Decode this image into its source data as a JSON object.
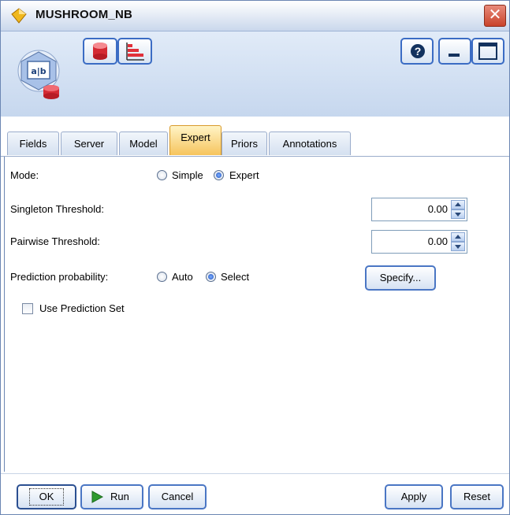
{
  "window": {
    "title": "MUSHROOM_NB",
    "close_glyph": "✕"
  },
  "toolbar": {
    "help_glyph": "?",
    "icons": [
      "node-naive-bayes-icon",
      "database-icon",
      "chart-icon",
      "help-icon",
      "minimize-icon",
      "maximize-icon"
    ]
  },
  "tabs": [
    {
      "label": "Fields"
    },
    {
      "label": "Server"
    },
    {
      "label": "Model"
    },
    {
      "label": "Expert"
    },
    {
      "label": "Priors"
    },
    {
      "label": "Annotations"
    }
  ],
  "active_tab": "Expert",
  "mode": {
    "label": "Mode:",
    "options": [
      "Simple",
      "Expert"
    ],
    "selected": "Expert"
  },
  "singleton": {
    "label": "Singleton Threshold:",
    "value": "0.00"
  },
  "pairwise": {
    "label": "Pairwise Threshold:",
    "value": "0.00"
  },
  "prediction": {
    "label": "Prediction probability:",
    "options": [
      "Auto",
      "Select"
    ],
    "selected": "Select",
    "specify_label": "Specify..."
  },
  "use_prediction_set": {
    "label": "Use Prediction Set",
    "checked": false
  },
  "buttons": {
    "ok": "OK",
    "run": "Run",
    "cancel": "Cancel",
    "apply": "Apply",
    "reset": "Reset"
  },
  "colors": {
    "active_tab": "#f6c45d",
    "button_border": "#4a76c4",
    "title_bar": "#dfe7f3",
    "toolbar_bg": "#c6d7ee"
  }
}
